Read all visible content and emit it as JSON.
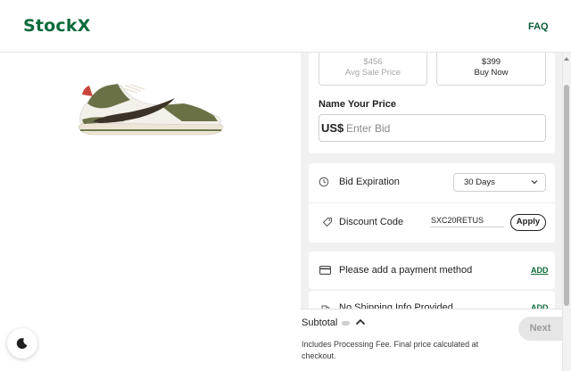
{
  "header": {
    "logo": "StockX",
    "faq": "FAQ"
  },
  "product": {
    "image": "sneaker-image"
  },
  "prices": {
    "avg_sale": {
      "value": "$456",
      "label": "Avg Sale Price"
    },
    "buy_now": {
      "value": "$399",
      "label": "Buy Now"
    }
  },
  "bid": {
    "label": "Name Your Price",
    "currency": "US$",
    "placeholder": "Enter Bid"
  },
  "expiration": {
    "label": "Bid Expiration",
    "selected": "30 Days"
  },
  "discount": {
    "label": "Discount Code",
    "code": "SXC20RETUS",
    "apply_label": "Apply"
  },
  "payment": {
    "label": "Please add a payment method",
    "add_label": "ADD"
  },
  "shipping": {
    "label": "No Shipping Info Provided",
    "add_label": "ADD"
  },
  "footer": {
    "subtotal_label": "Subtotal",
    "fee_note": "Includes Processing Fee. Final price calculated at checkout.",
    "next_label": "Next"
  },
  "colors": {
    "brand_green": "#0b6b3a",
    "panel_bg": "#f1f1f1"
  },
  "icons": [
    "clock-icon",
    "tag-icon",
    "credit-card-icon",
    "chevron-down-icon",
    "chevron-up-icon",
    "moon-icon"
  ]
}
